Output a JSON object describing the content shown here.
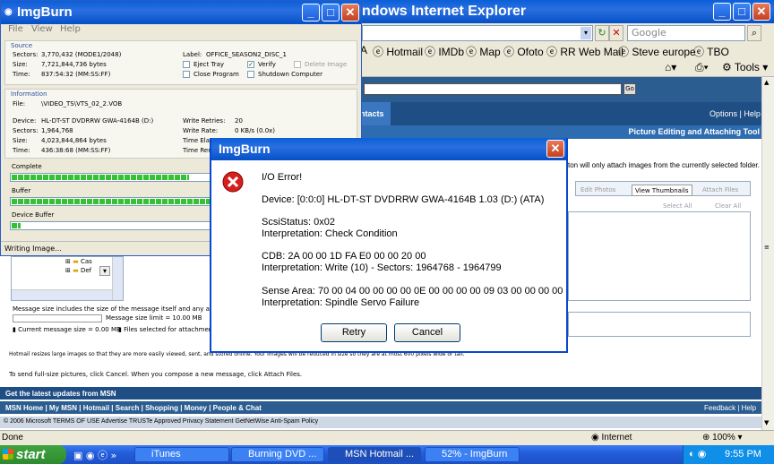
{
  "ie": {
    "title": "ndows Internet Explorer",
    "search_placeholder": "Google",
    "favorites": [
      "A",
      "Hotmail",
      "IMDb",
      "Map",
      "Ofoto",
      "RR Web Mail",
      "Steve europe",
      "TBO"
    ],
    "tools_label": "Tools",
    "status": "Done",
    "zone": "Internet",
    "zoom": "100%"
  },
  "msn": {
    "go_label": "Go",
    "tab_label": "ntacts",
    "options_label": "Options | Help",
    "tool_title": "Picture Editing and Attaching Tool",
    "attach_note": "ton will only attach images from the currently selected folder.",
    "edit_photos": "Edit Photos",
    "view_thumbnails": "View Thumbnails",
    "attach_files": "Attach Files",
    "select_all": "Select All",
    "clear_all": "Clear All",
    "tree_items": [
      "Cas",
      "Def"
    ],
    "msg_size_note": "Message size includes the size of the message itself and any attach",
    "msg_size_limit": "Message size limit = 10.00 MB",
    "current_size": "Current message size = 0.00 MB",
    "files_selected": "Files selected for attachment",
    "resize_note": "Hotmail resizes large images so that they are more easily viewed, sent, and stored online. Your images will be reduced in size so they are at most 600 pixels wide or tall.",
    "fullsize_note": "To send full-size pictures, click Cancel. When you compose a new message, click Attach Files.",
    "latest_updates": "Get the latest updates from MSN",
    "footer_links": "MSN Home | My MSN | Hotmail | Search | Shopping | Money | People & Chat",
    "feedback": "Feedback | Help",
    "copyright": "© 2006 Microsoft TERMS OF USE  Advertise  TRUSTe Approved Privacy Statement  GetNetWise  Anti-Spam Policy"
  },
  "imgburn": {
    "title": "ImgBurn",
    "menu": [
      "File",
      "View",
      "Help"
    ],
    "source": {
      "label": "Source",
      "sectors_k": "Sectors:",
      "sectors": "3,770,432 (MODE1/2048)",
      "size_k": "Size:",
      "size": "7,721,844,736 bytes",
      "time_k": "Time:",
      "time": "837:54:32 (MM:SS:FF)",
      "disc_label_k": "Label:",
      "disc_label": "OFFICE_SEASON2_DISC_1",
      "eject_tray": "Eject Tray",
      "verify": "Verify",
      "delete_image": "Delete Image",
      "close_program": "Close Program",
      "shutdown": "Shutdown Computer"
    },
    "information": {
      "label": "Information",
      "file_k": "File:",
      "file": "\\VIDEO_TS\\VTS_02_2.VOB",
      "device_k": "Device:",
      "device": "HL-DT-ST DVDRRW GWA-4164B (D:)",
      "sectors_k": "Sectors:",
      "sectors": "1,964,768",
      "size_k": "Size:",
      "size": "4,023,844,864 bytes",
      "time_k": "Time:",
      "time": "436:38:68 (MM:SS:FF)",
      "write_retries_k": "Write Retries:",
      "write_retries": "20",
      "write_rate_k": "Write Rate:",
      "write_rate": "0 KB/s (0.0x)",
      "time_elapsed_k": "Time Elaps",
      "time_remaining_k": "Time Rema"
    },
    "complete_label": "Complete",
    "buffer_label": "Buffer",
    "device_buffer_label": "Device Buffer",
    "complete_pct": 52,
    "buffer_pct": 100,
    "device_buffer_pct": 3,
    "status": "Writing Image..."
  },
  "dialog": {
    "title": "ImgBurn",
    "heading": "I/O Error!",
    "device": "Device: [0:0:0] HL-DT-ST DVDRRW GWA-4164B 1.03 (D:) (ATA)",
    "scsi_status": "ScsiStatus: 0x02",
    "interpretation1": "Interpretation: Check Condition",
    "cdb": "CDB: 2A 00 00 1D FA E0 00 00 20 00",
    "interpretation2": "Interpretation: Write (10) - Sectors: 1964768 - 1964799",
    "sense_area": "Sense Area: 70 00 04 00 00 00 00 0E 00 00 00 00 09 03 00 00 00 00",
    "interpretation3": "Interpretation: Spindle Servo Failure",
    "retry_label": "Retry",
    "cancel_label": "Cancel"
  },
  "taskbar": {
    "start_label": "start",
    "tasks": [
      "iTunes",
      "Burning DVD ...",
      "MSN Hotmail ...",
      "52% - ImgBurn"
    ],
    "time": "9:55 PM"
  }
}
